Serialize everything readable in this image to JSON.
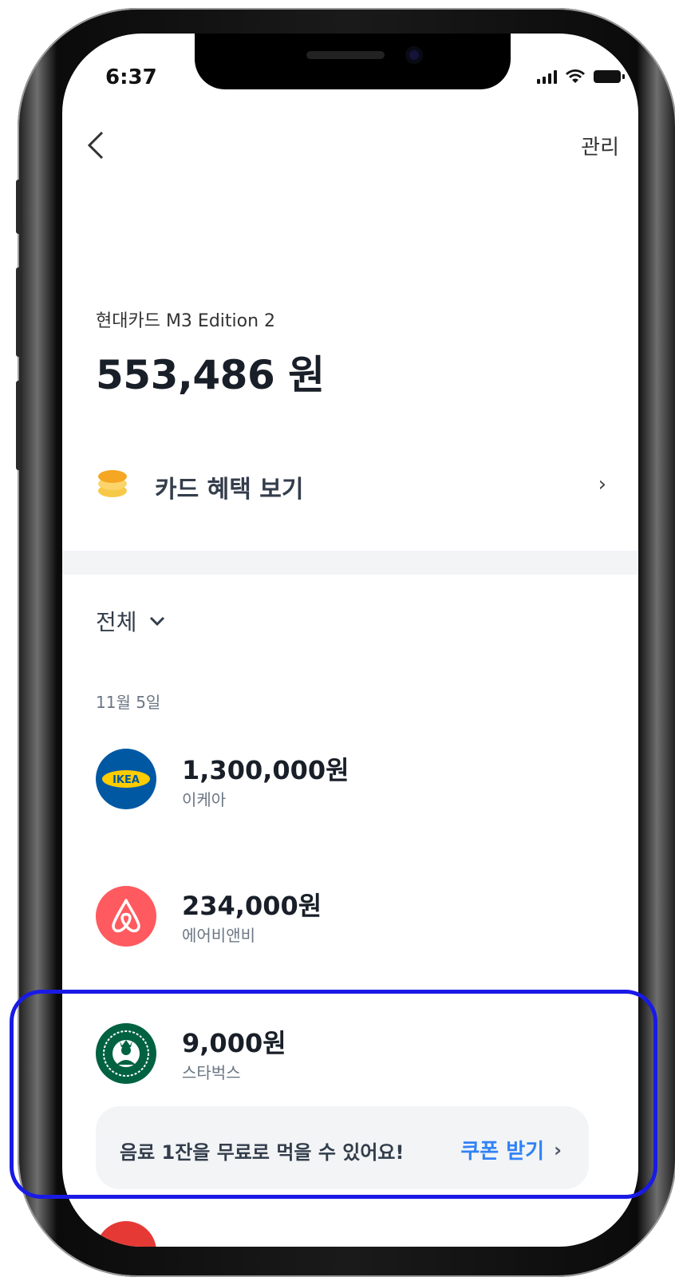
{
  "status_bar": {
    "time": "6:37"
  },
  "header": {
    "manage_label": "관리"
  },
  "card": {
    "name": "현대카드 M3 Edition 2",
    "amount": "553,486 원"
  },
  "benefit": {
    "label": "카드 혜택 보기"
  },
  "filter": {
    "label": "전체"
  },
  "date_group": "11월 5일",
  "transactions": [
    {
      "amount": "1,300,000원",
      "merchant": "이케아",
      "logo_text": "IKEA",
      "logo_color": "#0058a3",
      "icon": "ikea-logo-icon"
    },
    {
      "amount": "234,000원",
      "merchant": "에어비앤비",
      "logo_color": "#ff5a5f",
      "icon": "airbnb-logo-icon"
    },
    {
      "amount": "9,000원",
      "merchant": "스타벅스",
      "logo_color": "#006241",
      "icon": "starbucks-logo-icon"
    }
  ],
  "coupon": {
    "message": "음료 1잔을 무료로 먹을 수 있어요!",
    "button_label": "쿠폰 받기"
  },
  "colors": {
    "accent": "#3182f6",
    "highlight": "#1a1ae6",
    "divider": "#f2f4f6"
  }
}
